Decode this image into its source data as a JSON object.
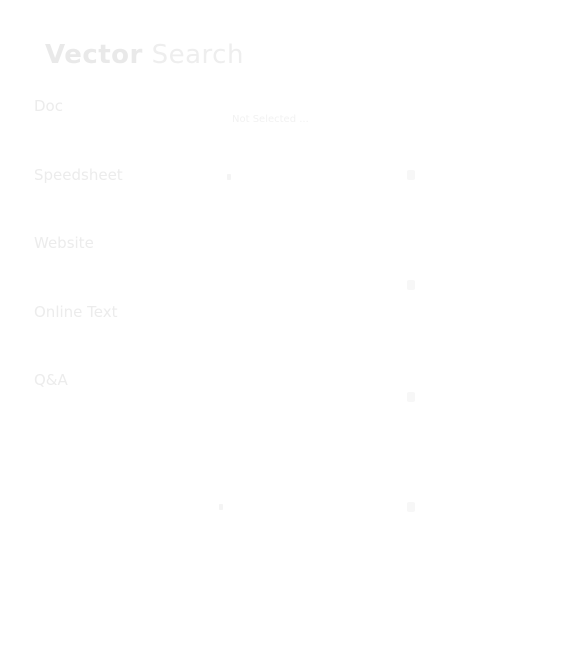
{
  "header": {
    "title_part1": "Vector",
    "title_part2": "Search"
  },
  "sidebar": {
    "items": [
      {
        "label": "Doc"
      },
      {
        "label": "Speedsheet"
      },
      {
        "label": "Website"
      },
      {
        "label": "Online Text"
      },
      {
        "label": "Q&A"
      }
    ]
  },
  "panel": {
    "caption": "Not Selected  ..."
  }
}
